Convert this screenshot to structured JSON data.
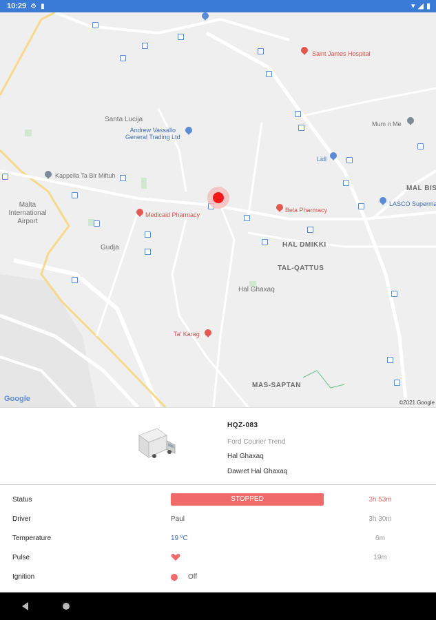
{
  "status_bar": {
    "time": "10:29"
  },
  "map": {
    "labels": {
      "santa_lucija": "Santa Lucija",
      "andrew_vassallo": "Andrew Vassallo",
      "general_trading": "General Trading Ltd",
      "kappella": "Kappella Ta Bir Miftuh",
      "malta_airport": "Malta International Airport",
      "medicaid": "Medicaid Pharmacy",
      "bela": "Bela Pharmacy",
      "hal_dmikki": "HAL DMIKKI",
      "tal_qattus": "TAL-QATTUS",
      "hal_ghaxaq": "Hal Ghaxaq",
      "ta_karag": "Ta' Karag",
      "mas_saptan": "MAS-SAPTAN",
      "gudja": "Gudja",
      "saint_james": "Saint James Hospital",
      "lidl": "Lidl",
      "mum_n_me": "Mum n Me",
      "mal_bisb": "MAL BISB",
      "lasco": "LASCO Supermar"
    },
    "google_logo": "Google",
    "copyright": "©2021 Google"
  },
  "vehicle": {
    "plate": "HQZ-083",
    "model": "Ford Courier Trend",
    "location_1": "Hal Ghaxaq",
    "location_2": "Dawret Hal Ghaxaq"
  },
  "details": {
    "status": {
      "label": "Status",
      "value": "STOPPED",
      "time": "3h 53m"
    },
    "driver": {
      "label": "Driver",
      "value": "Paul",
      "time": "3h 30m"
    },
    "temperature": {
      "label": "Temperature",
      "value": "19 ºC",
      "time": "6m"
    },
    "pulse": {
      "label": "Pulse",
      "time": "19m"
    },
    "ignition": {
      "label": "Ignition",
      "value": "Off"
    }
  },
  "colors": {
    "status_bar": "#3b7bd8",
    "stopped": "#f06a6a",
    "accent_blue": "#3e6fb5"
  }
}
